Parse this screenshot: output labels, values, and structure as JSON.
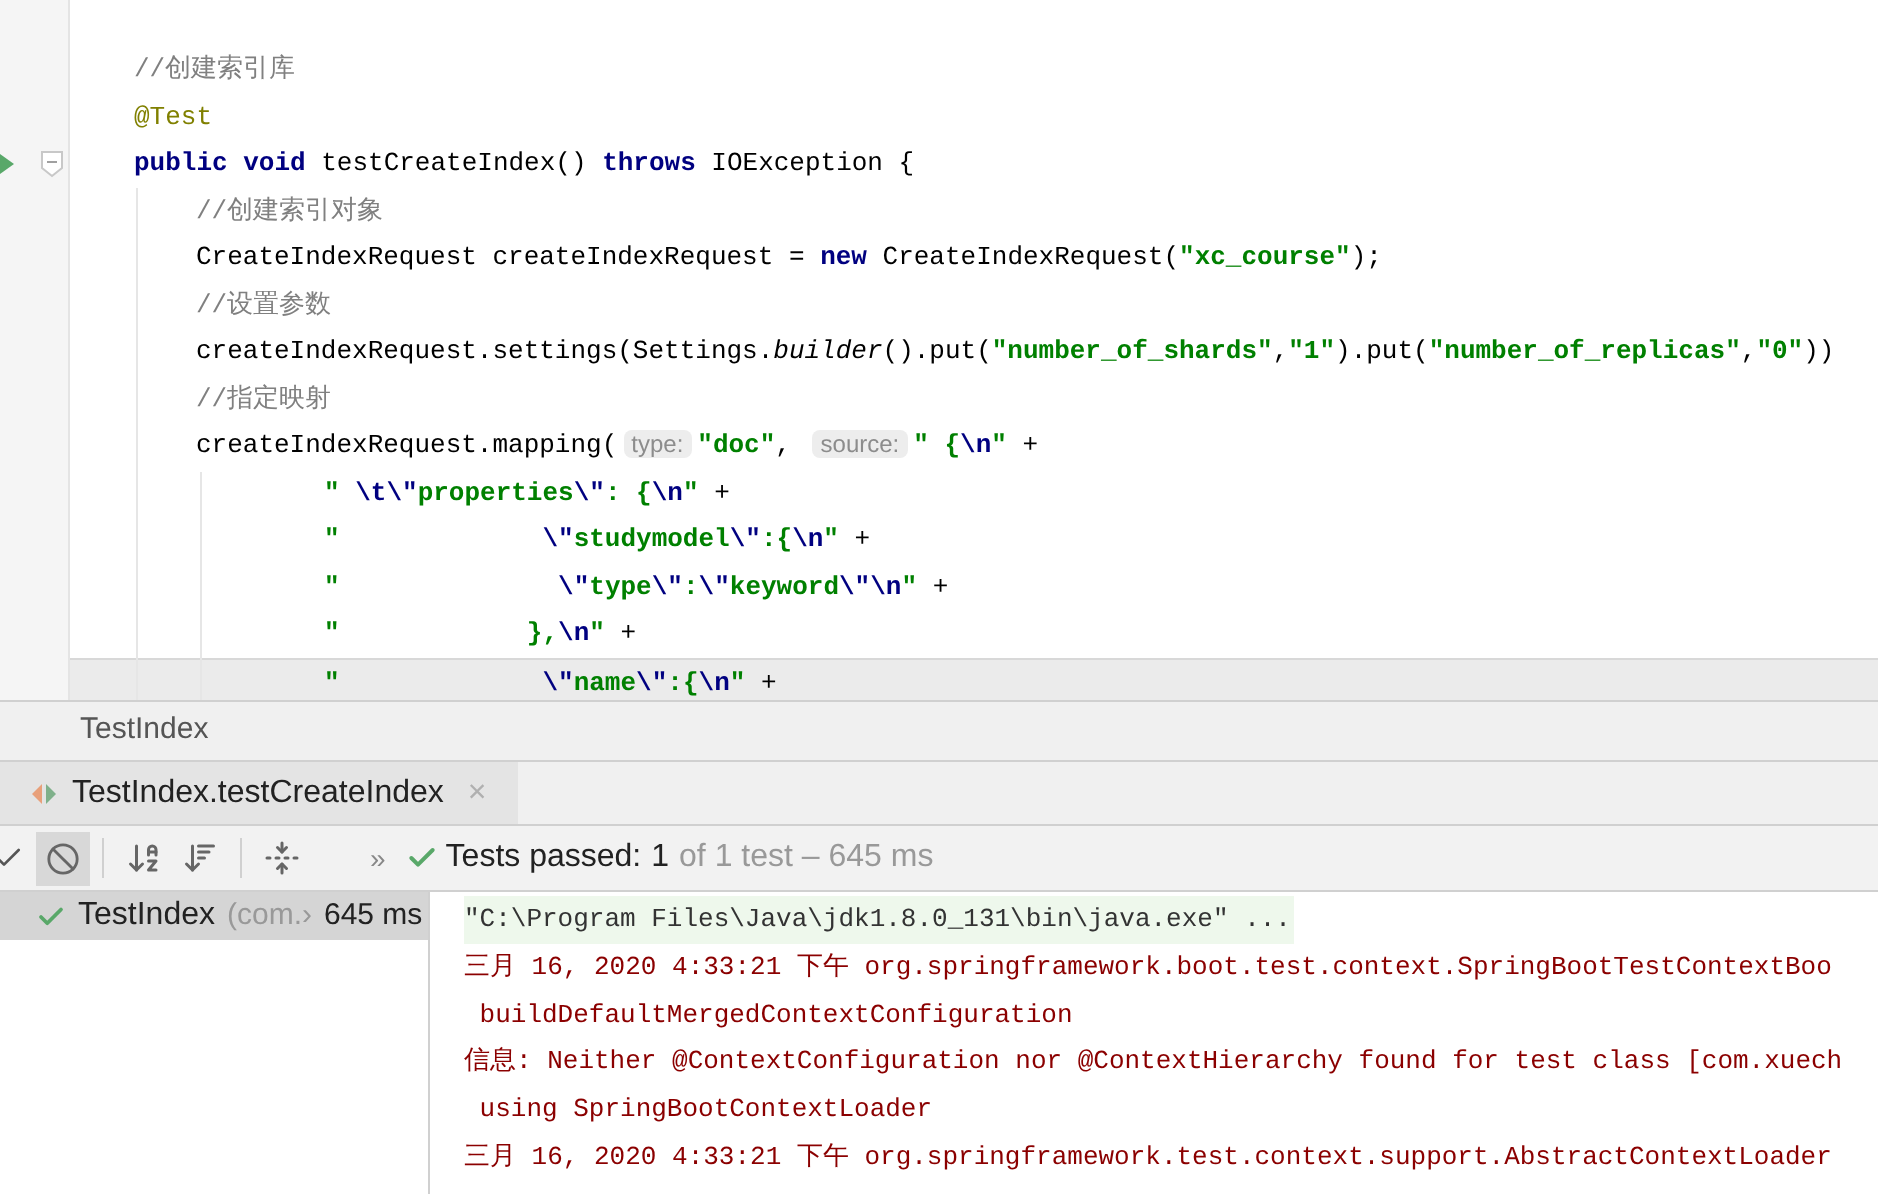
{
  "editor": {
    "lines": [
      {
        "kind": "top",
        "current": false,
        "segments": [
          {
            "kind": "comment",
            "text": "//创建索引库"
          }
        ]
      },
      {
        "kind": "top",
        "current": false,
        "segments": [
          {
            "kind": "annotation",
            "text": "@Test"
          }
        ]
      },
      {
        "kind": "top",
        "current": false,
        "segments": [
          {
            "kind": "keyword",
            "text": "public void "
          },
          {
            "kind": "plain",
            "text": "testCreateIndex() "
          },
          {
            "kind": "keyword",
            "text": "throws "
          },
          {
            "kind": "plain",
            "text": "IOException {"
          }
        ]
      },
      {
        "kind": "body",
        "current": false,
        "segments": [
          {
            "kind": "comment",
            "text": "//创建索引对象"
          }
        ]
      },
      {
        "kind": "body",
        "current": false,
        "segments": [
          {
            "kind": "plain",
            "text": "CreateIndexRequest createIndexRequest = "
          },
          {
            "kind": "keyword",
            "text": "new "
          },
          {
            "kind": "plain",
            "text": "CreateIndexRequest("
          },
          {
            "kind": "string",
            "text": "\"xc_course\""
          },
          {
            "kind": "plain",
            "text": ");"
          }
        ]
      },
      {
        "kind": "body",
        "current": false,
        "segments": [
          {
            "kind": "comment",
            "text": "//设置参数"
          }
        ]
      },
      {
        "kind": "body",
        "current": false,
        "segments": [
          {
            "kind": "plain",
            "text": "createIndexRequest.settings(Settings."
          },
          {
            "kind": "italic",
            "text": "builder"
          },
          {
            "kind": "plain",
            "text": "().put("
          },
          {
            "kind": "string",
            "text": "\"number_of_shards\""
          },
          {
            "kind": "plain",
            "text": ","
          },
          {
            "kind": "string",
            "text": "\"1\""
          },
          {
            "kind": "plain",
            "text": ").put("
          },
          {
            "kind": "string",
            "text": "\"number_of_replicas\""
          },
          {
            "kind": "plain",
            "text": ","
          },
          {
            "kind": "string",
            "text": "\"0\""
          },
          {
            "kind": "plain",
            "text": "))"
          }
        ]
      },
      {
        "kind": "body",
        "current": false,
        "segments": [
          {
            "kind": "comment",
            "text": "//指定映射"
          }
        ]
      },
      {
        "kind": "body",
        "current": false,
        "segments": [
          {
            "kind": "plain",
            "text": "createIndexRequest.mapping("
          },
          {
            "kind": "hint",
            "text": "type:"
          },
          {
            "kind": "string",
            "text": "\"doc\""
          },
          {
            "kind": "plain",
            "text": ", "
          },
          {
            "kind": "hint",
            "text": "source:"
          },
          {
            "kind": "string",
            "text": "\" {"
          },
          {
            "kind": "escape",
            "text": "\\n"
          },
          {
            "kind": "string",
            "text": "\""
          },
          {
            "kind": "plain",
            "text": " +"
          }
        ]
      },
      {
        "kind": "continuation",
        "current": false,
        "segments": [
          {
            "kind": "string",
            "text": "\" "
          },
          {
            "kind": "escape",
            "text": "\\t\\\""
          },
          {
            "kind": "string",
            "text": "properties"
          },
          {
            "kind": "escape",
            "text": "\\\""
          },
          {
            "kind": "string",
            "text": ": {"
          },
          {
            "kind": "escape",
            "text": "\\n"
          },
          {
            "kind": "string",
            "text": "\""
          },
          {
            "kind": "plain",
            "text": " +"
          }
        ]
      },
      {
        "kind": "continuation",
        "current": false,
        "segments": [
          {
            "kind": "string",
            "text": "\"             "
          },
          {
            "kind": "escape",
            "text": "\\\""
          },
          {
            "kind": "string",
            "text": "studymodel"
          },
          {
            "kind": "escape",
            "text": "\\\""
          },
          {
            "kind": "string",
            "text": ":{"
          },
          {
            "kind": "escape",
            "text": "\\n"
          },
          {
            "kind": "string",
            "text": "\""
          },
          {
            "kind": "plain",
            "text": " +"
          }
        ]
      },
      {
        "kind": "continuation",
        "current": false,
        "segments": [
          {
            "kind": "string",
            "text": "\"              "
          },
          {
            "kind": "escape",
            "text": "\\\""
          },
          {
            "kind": "string",
            "text": "type"
          },
          {
            "kind": "escape",
            "text": "\\\""
          },
          {
            "kind": "string",
            "text": ":"
          },
          {
            "kind": "escape",
            "text": "\\\""
          },
          {
            "kind": "string",
            "text": "keyword"
          },
          {
            "kind": "escape",
            "text": "\\\"\\n"
          },
          {
            "kind": "string",
            "text": "\""
          },
          {
            "kind": "plain",
            "text": " +"
          }
        ]
      },
      {
        "kind": "continuation",
        "current": false,
        "segments": [
          {
            "kind": "string",
            "text": "\"            },"
          },
          {
            "kind": "escape",
            "text": "\\n"
          },
          {
            "kind": "string",
            "text": "\""
          },
          {
            "kind": "plain",
            "text": " +"
          }
        ]
      },
      {
        "kind": "continuation",
        "current": true,
        "segments": [
          {
            "kind": "string",
            "text": "\"             "
          },
          {
            "kind": "escape",
            "text": "\\\""
          },
          {
            "kind": "string",
            "text": "name"
          },
          {
            "kind": "escape",
            "text": "\\\""
          },
          {
            "kind": "string",
            "text": ":{"
          },
          {
            "kind": "escape",
            "text": "\\n"
          },
          {
            "kind": "string",
            "text": "\""
          },
          {
            "kind": "plain",
            "text": " +"
          }
        ]
      }
    ]
  },
  "run_panel": {
    "title": "TestIndex",
    "tabs": [
      {
        "label": "TestIndex.testCreateIndex",
        "close": "×",
        "selected": true
      }
    ],
    "toolbar": {
      "more": "»",
      "status_label": "Tests passed:",
      "status_count": "1",
      "status_detail": "of 1 test – 645 ms"
    },
    "tree": [
      {
        "name": "TestIndex",
        "detail": "(com.›",
        "duration": "645 ms",
        "selected": true
      }
    ],
    "console": [
      {
        "kind": "command",
        "text": "\"C:\\Program Files\\Java\\jdk1.8.0_131\\bin\\java.exe\" ..."
      },
      {
        "kind": "log",
        "text": "三月 16, 2020 4:33:21 下午 org.springframework.boot.test.context.SpringBootTestContextBoo"
      },
      {
        "kind": "log",
        "text": " buildDefaultMergedContextConfiguration"
      },
      {
        "kind": "log",
        "text": "信息: Neither @ContextConfiguration nor @ContextHierarchy found for test class [com.xuech"
      },
      {
        "kind": "log",
        "text": " using SpringBootContextLoader"
      },
      {
        "kind": "log",
        "text": "三月 16, 2020 4:33:21 下午 org.springframework.test.context.support.AbstractContextLoader"
      }
    ]
  }
}
